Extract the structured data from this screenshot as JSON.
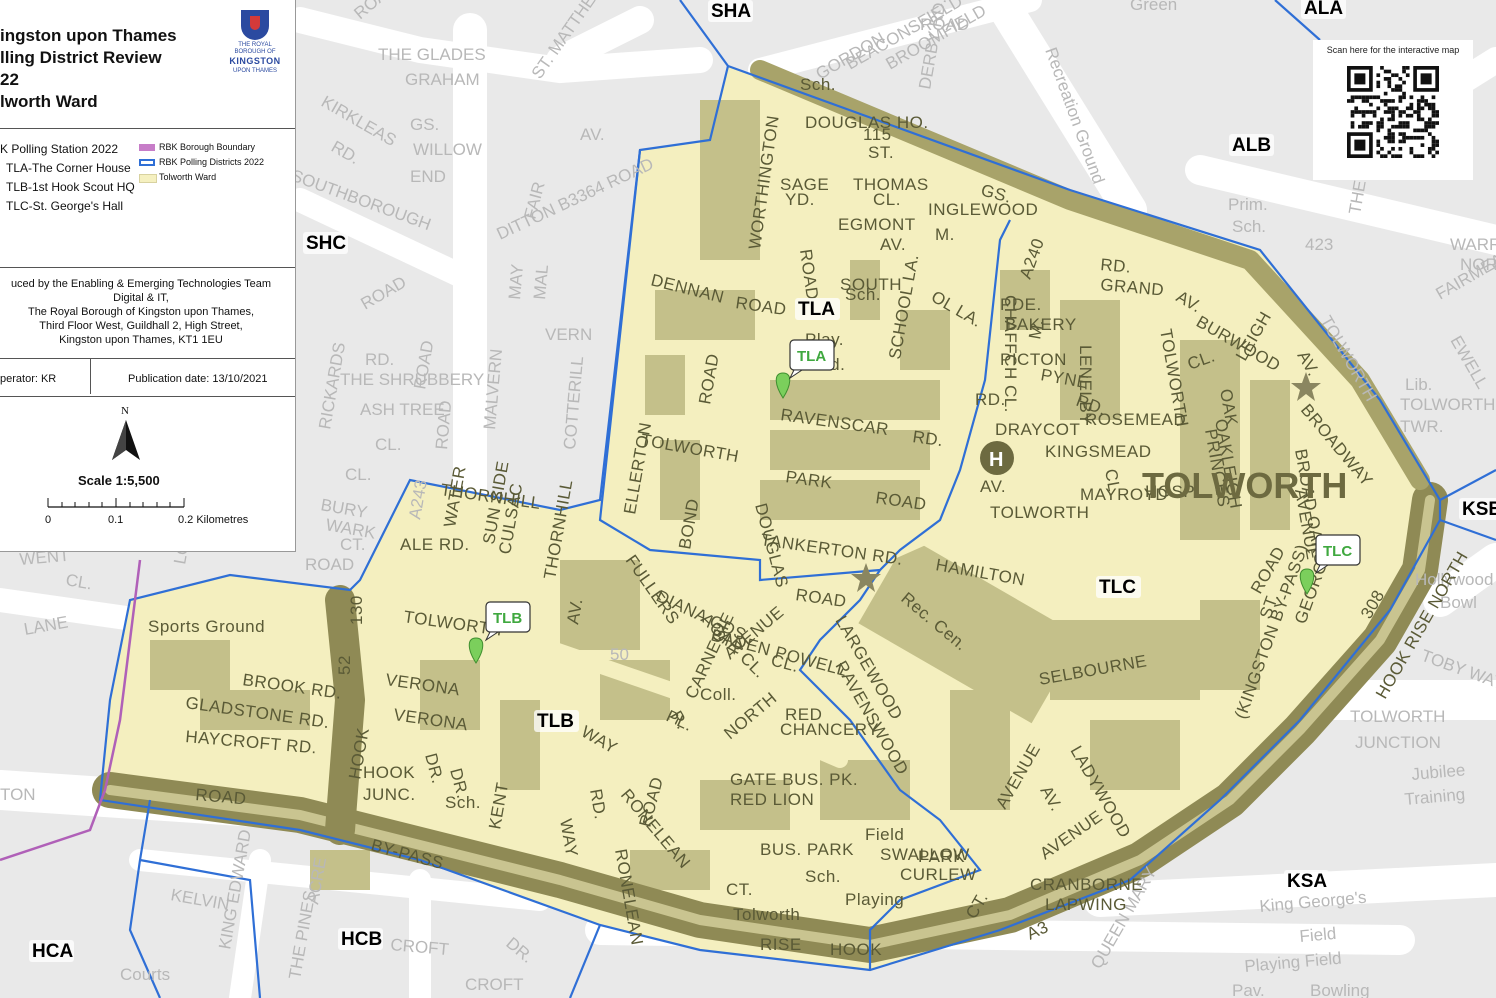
{
  "header": {
    "title_lines": [
      "ingston upon Thames",
      "lling District Review",
      "22",
      "lworth Ward"
    ],
    "crest_text": "THE ROYAL BOROUGH OF",
    "crest_name": "KINGSTON",
    "crest_sub": "UPON THAMES"
  },
  "legend": {
    "station_heading": "K Polling Station 2022",
    "stations": [
      "TLA-The Corner House",
      "TLB-1st Hook Scout HQ",
      "TLC-St. George's Hall"
    ],
    "layers": [
      {
        "label": "RBK Borough Boundary",
        "color": "#c77dc8"
      },
      {
        "label": "RBK Polling Districts 2022",
        "color": "#2f6fd6"
      },
      {
        "label": "Tolworth Ward",
        "color": "#f5f0c0"
      }
    ],
    "credit_lines": [
      "uced by the Enabling & Emerging Technologies Team",
      "Digital & IT,",
      "The Royal Borough of Kingston upon Thames,",
      "Third Floor West, Guildhall 2, High Street,",
      "Kingston upon Thames, KT1 1EU"
    ],
    "operator": "perator: KR",
    "publication": "Publication date: 13/10/2021",
    "north": "N",
    "scale": "Scale 1:5,500",
    "scale_ticks": [
      "0",
      "0.1",
      "0.2 Kilometres"
    ]
  },
  "qr": {
    "caption": "Scan here for the interactive map"
  },
  "districts": [
    "SHA",
    "ALA",
    "ALB",
    "SHC",
    "TLA",
    "TLB",
    "TLC",
    "KSB",
    "KSA",
    "HCA",
    "HCB"
  ],
  "pins": [
    "TLA",
    "TLB",
    "TLC"
  ],
  "streets": {
    "olive": [
      "DOUGLAS HO.",
      "ST.",
      "THOMAS",
      "CL.",
      "INGLEWOOD",
      "M.",
      "EGMONT",
      "AV.",
      "SAGE",
      "YD.",
      "WORTHINGTON",
      "ROAD",
      "DENNAN",
      "ROAD",
      "Sch.",
      "SCHOOL LA.",
      "OL LA.",
      "Play.",
      "Fld.",
      "ROAD",
      "RAVENSCAR",
      "RD.",
      "TOLWORTH",
      "PARK",
      "ROAD",
      "ELLERTON",
      "BOND",
      "DOUGLAS",
      "TANKERTON RD.",
      "ROAD",
      "HAMILTON",
      "THORNHILL",
      "WATER",
      "SUN SIDE",
      "CULSAC",
      "ALE RD.",
      "TOLWORTH",
      "THORNHILL",
      "AV.",
      "FULLERS",
      "DIANA GDS.",
      "AGAR CL.",
      "BADEN POWELL",
      "CL.",
      "AVENUE",
      "Sports Ground",
      "BROOK RD.",
      "GLADSTONE RD.",
      "HAYCROFT RD.",
      "VERONA",
      "VERONA",
      "DR.",
      "DR.",
      "HOOK",
      "HOOK",
      "JUNC.",
      "Sch.",
      "KENT",
      "WAY",
      "WAY",
      "RONELEAN",
      "RD.",
      "RONELEAN",
      "R.",
      "CARNEGIE",
      "PL.",
      "ROAD",
      "NORTH",
      "RED",
      "CHANCERY",
      "GATE BUS. PK.",
      "RED LION",
      "BUS. PARK",
      "Sch.",
      "Playing",
      "Field",
      "SWALLOW",
      "PARK",
      "CURLEW",
      "CT.",
      "Tolworth",
      "Rec. Cen.",
      "LARGEWOOD",
      "RAVENSWOOD",
      "SELBOURNE",
      "LADYWOOD",
      "AVENUE",
      "AV.",
      "AVENUE",
      "CRANBORNE",
      "LAPWING",
      "CT.",
      "CHAFFCH CL.",
      "LENELBY",
      "RD.",
      "GRAND",
      "PDE.",
      "BAKERY",
      "M.",
      "PICTON",
      "PYNE",
      "RD.",
      "DRAYCOT",
      "RD.",
      "ROSEMEAD",
      "CL.",
      "KINGSMEAD",
      "MAYROYD",
      "AV.",
      "TOLWORTH",
      "HOSP.",
      "TOLWORTH",
      "PRINCES",
      "AV.",
      "BURWOOD",
      "CL.",
      "OAK",
      "LEIGH",
      "OAKLEIGH",
      "AV.",
      "BROADWAY",
      "BROAD OAKS",
      "AVENUE",
      "ROAD",
      "ST.",
      "GEORGE'S",
      "GS.",
      "A240",
      "ROAD",
      "BY-PASS",
      "HOOK",
      "RISE",
      "A3",
      "(KINGSTON BY-PASS)",
      "52",
      "130",
      "115",
      "308",
      "HOOK RISE NORTH",
      "SOUTH",
      "Sch.",
      "Coll."
    ],
    "grey": [
      "ROAD",
      "BEACONSFIELD",
      "GORDON",
      "ROAD",
      "BROOMFIELD",
      "DERBY RD.",
      "Recreation Ground",
      "Green",
      "ST. MATTHEW'S",
      "AV.",
      "THE GLADES",
      "GRAHAM",
      "GS.",
      "WILLOW",
      "END",
      "KIRKLEAS",
      "RD.",
      "SOUTHBOROUGH",
      "ROAD",
      "ROAD",
      "DITTON B3364 ROAD",
      "FAIR",
      "MAY",
      "MAL",
      "VERN",
      "RD.",
      "THE SHRUBBERY",
      "ASH TREE",
      "CL.",
      "RICKARDS",
      "CL.",
      "MALVERN",
      "COTTERILL",
      "A243",
      "ROAD",
      "LANE",
      "WENT",
      "CL.",
      "TON",
      "KELVIN",
      "ACRE",
      "KING EDWARD",
      "THE PINES",
      "Courts",
      "CROFT",
      "DR.",
      "CROFT",
      "QUEEN MARY",
      "King George's",
      "Field",
      "Playing Field",
      "Pav.",
      "Bowling",
      "Hollywood",
      "Bowl",
      "TOLWORTH",
      "JUNCTION",
      "Jubilee",
      "Training",
      "TOLWORTH",
      "TWR.",
      "Lib.",
      "FAIRMEAD",
      "WARREN",
      "NORTH",
      "423",
      "Prim.",
      "Sch.",
      "THE CROSS",
      "TOBY WAY",
      "EWELL",
      "TOLWORTH",
      "50",
      "LOVE",
      "ROAD",
      "BURY",
      "WARK",
      "CT."
    ]
  }
}
